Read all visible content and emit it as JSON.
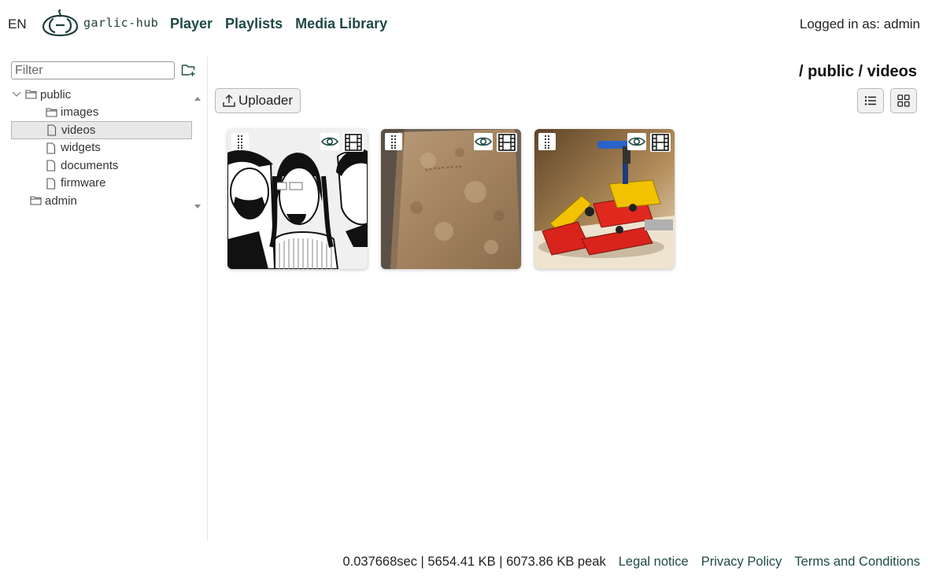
{
  "header": {
    "lang": "EN",
    "logo_text": "garlic-hub",
    "nav": [
      "Player",
      "Playlists",
      "Media Library"
    ],
    "user": "Logged in as: admin"
  },
  "sidebar": {
    "filter_placeholder": "Filter",
    "tree": [
      {
        "label": "public",
        "type": "folder",
        "expanded": true
      },
      {
        "label": "images",
        "type": "folder"
      },
      {
        "label": "videos",
        "type": "file",
        "selected": true
      },
      {
        "label": "widgets",
        "type": "file"
      },
      {
        "label": "documents",
        "type": "file"
      },
      {
        "label": "firmware",
        "type": "file"
      },
      {
        "label": "admin",
        "type": "folder"
      }
    ]
  },
  "main": {
    "breadcrumb": "/ public / videos",
    "uploader_label": "Uploader",
    "media": [
      {
        "thumbnail": "cartoon-people",
        "type": "video"
      },
      {
        "thumbnail": "old-notebook",
        "type": "video"
      },
      {
        "thumbnail": "lego-robot",
        "type": "video"
      }
    ]
  },
  "footer": {
    "stats": "0.037668sec | 5654.41 KB | 6073.86 KB peak",
    "links": [
      "Legal notice",
      "Privacy Policy",
      "Terms and Conditions"
    ]
  },
  "colors": {
    "nav": "#1f4a45",
    "text": "#222222",
    "selected_bg": "#e8e8e8"
  }
}
